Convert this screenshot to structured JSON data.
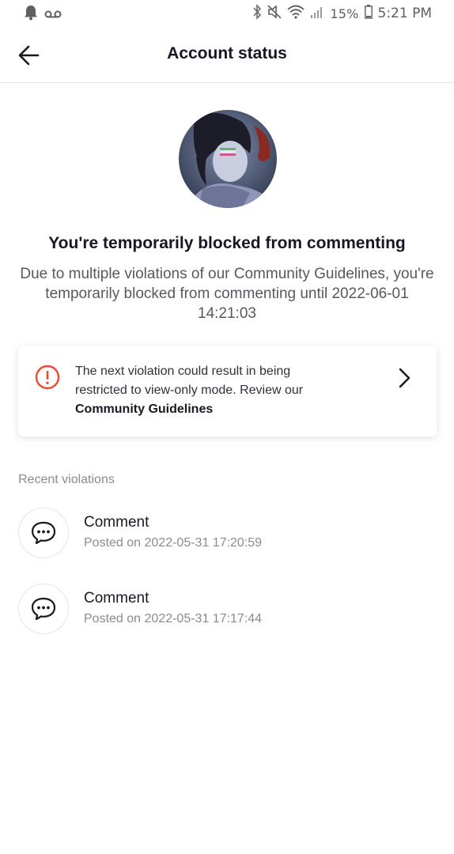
{
  "status_bar": {
    "battery": "15%",
    "time": "5:21 PM",
    "icons": [
      "bell-icon",
      "voicemail-icon",
      "bluetooth-icon",
      "mute-icon",
      "wifi-icon",
      "signal-icon",
      "battery-icon"
    ]
  },
  "header": {
    "title": "Account status",
    "back_icon": "arrow-left-icon"
  },
  "block": {
    "title": "You're temporarily blocked from commenting",
    "description": "Due to multiple violations of our Community Guidelines, you're temporarily blocked from commenting until 2022-06-01 14:21:03"
  },
  "warning": {
    "icon": "alert-circle-icon",
    "text": "The next violation could result in being restricted to view-only mode. Review our",
    "link": "Community Guidelines",
    "accent_color": "#fe2c55"
  },
  "recent": {
    "label": "Recent violations",
    "items": [
      {
        "title": "Comment",
        "subtitle": "Posted on 2022-05-31 17:20:59",
        "icon": "comment-bubble-icon"
      },
      {
        "title": "Comment",
        "subtitle": "Posted on 2022-05-31 17:17:44",
        "icon": "comment-bubble-icon"
      }
    ]
  }
}
